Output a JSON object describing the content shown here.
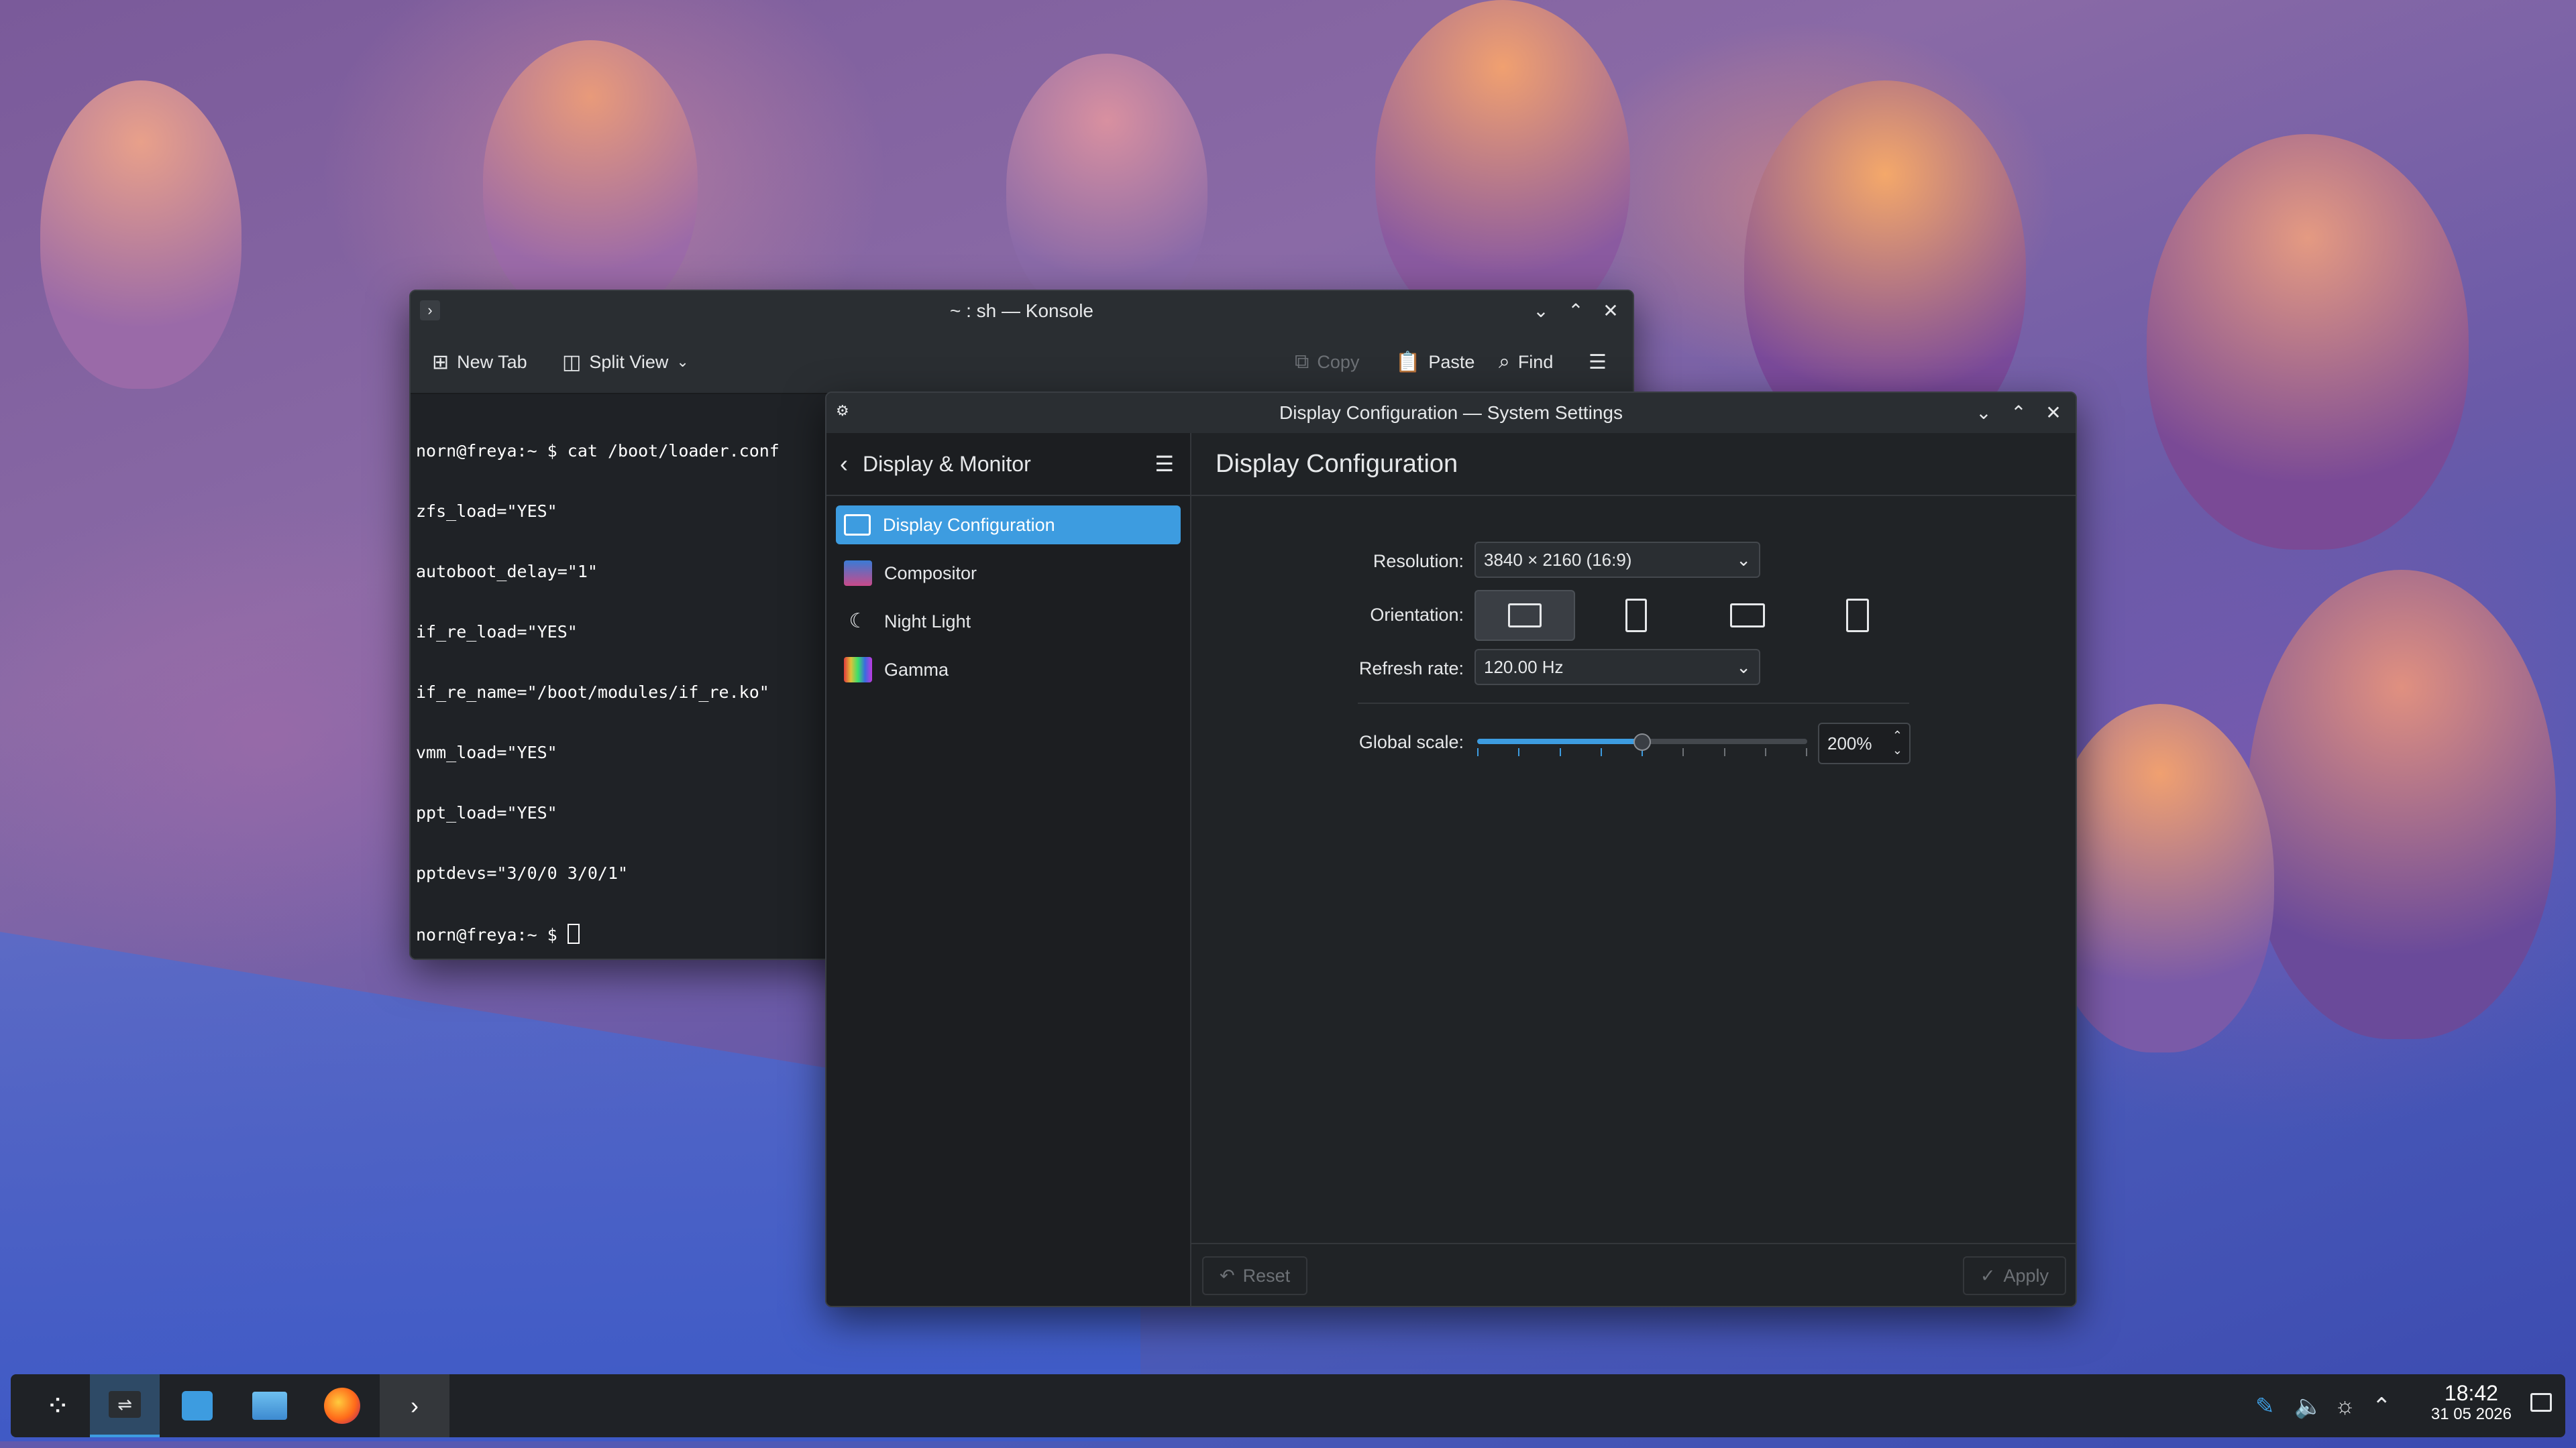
{
  "konsole": {
    "title": "~ : sh — Konsole",
    "toolbar": {
      "new_tab": "New Tab",
      "split_view": "Split View",
      "copy": "Copy",
      "paste": "Paste",
      "find": "Find"
    },
    "terminal_lines": [
      "norn@freya:~ $ cat /boot/loader.conf",
      "zfs_load=\"YES\"",
      "autoboot_delay=\"1\"",
      "if_re_load=\"YES\"",
      "if_re_name=\"/boot/modules/if_re.ko\"",
      "vmm_load=\"YES\"",
      "ppt_load=\"YES\"",
      "pptdevs=\"3/0/0 3/0/1\"",
      "norn@freya:~ $ "
    ]
  },
  "settings": {
    "title": "Display Configuration — System Settings",
    "sidebar": {
      "header": "Display & Monitor",
      "items": [
        {
          "label": "Display Configuration",
          "icon": "monitor-icon"
        },
        {
          "label": "Compositor",
          "icon": "compositor-icon"
        },
        {
          "label": "Night Light",
          "icon": "night-light-icon"
        },
        {
          "label": "Gamma",
          "icon": "gamma-icon"
        }
      ]
    },
    "page_title": "Display Configuration",
    "resolution_label": "Resolution:",
    "resolution_value": "3840 × 2160 (16:9)",
    "orientation_label": "Orientation:",
    "refresh_label": "Refresh rate:",
    "refresh_value": "120.00 Hz",
    "scale_label": "Global scale:",
    "scale_value": "200%",
    "scale_fraction": 0.5,
    "reset_label": "Reset",
    "apply_label": "Apply"
  },
  "taskbar": {
    "time": "18:42",
    "date": "31 05 2026"
  },
  "colors": {
    "accent": "#3d9ce0",
    "window_bg": "#202326",
    "sidebar_bg": "#1c1e21",
    "taskbar_bg": "#1f2226"
  }
}
